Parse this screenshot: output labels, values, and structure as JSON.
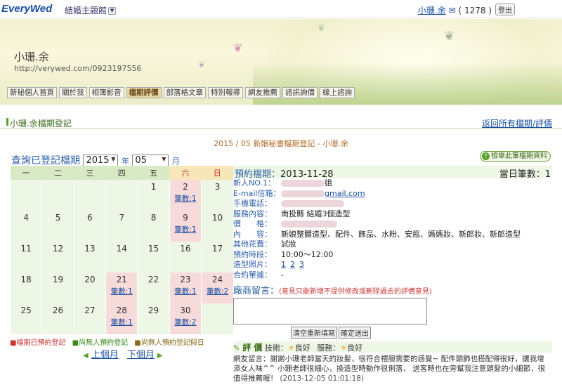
{
  "topbar": {
    "logo": "EveryWed",
    "site": "結婚主題館",
    "user_name": "小珊.余",
    "mail_count": "( 1278 )",
    "logout": "登出"
  },
  "banner": {
    "title": "小珊.余",
    "url": "http://verywed.com/0923197556",
    "nav": [
      "新秘個人首頁",
      "關於我",
      "相簿影音",
      "檔期評價",
      "部落格文章",
      "特別報導",
      "網友推薦",
      "諮訊詢價",
      "線上諮詢"
    ],
    "active_nav": "檔期評價"
  },
  "section": {
    "title": "小珊.余檔期登記",
    "back_link": "返回所有檔期/評價"
  },
  "calendar_title": "2015 / 05 新娘秘書檔期登記 - 小珊.余",
  "query": {
    "label": "查詢已登記檔期",
    "year": "2015",
    "year_unit": "年",
    "month": "05",
    "month_unit": "月"
  },
  "help_button": "檢舉此筆檔期資料",
  "calendar": {
    "weekdays": [
      "一",
      "二",
      "三",
      "四",
      "五",
      "六",
      "日"
    ],
    "weeks": [
      [
        {
          "d": ""
        },
        {
          "d": ""
        },
        {
          "d": ""
        },
        {
          "d": ""
        },
        {
          "d": "1"
        },
        {
          "d": "2",
          "c": "筆數:1"
        },
        {
          "d": "3"
        }
      ],
      [
        {
          "d": "4"
        },
        {
          "d": "5"
        },
        {
          "d": "6"
        },
        {
          "d": "7"
        },
        {
          "d": "8"
        },
        {
          "d": "9",
          "c": "筆數:1"
        },
        {
          "d": "10"
        }
      ],
      [
        {
          "d": "11"
        },
        {
          "d": "12"
        },
        {
          "d": "13"
        },
        {
          "d": "14"
        },
        {
          "d": "15"
        },
        {
          "d": "16"
        },
        {
          "d": "17"
        }
      ],
      [
        {
          "d": "18"
        },
        {
          "d": "19"
        },
        {
          "d": "20"
        },
        {
          "d": "21",
          "c": "筆數:1"
        },
        {
          "d": "22"
        },
        {
          "d": "23",
          "c": "筆數:1"
        },
        {
          "d": "24",
          "c": "筆數:2"
        }
      ],
      [
        {
          "d": "25"
        },
        {
          "d": "26"
        },
        {
          "d": "27"
        },
        {
          "d": "28",
          "c": "筆數:1"
        },
        {
          "d": "29"
        },
        {
          "d": "30",
          "c": "筆數:2"
        },
        {
          "d": ""
        }
      ]
    ]
  },
  "legend": {
    "booked": "■檔期已預約登記",
    "free": "■尚無人預約登記",
    "free_holiday": "■尚無人預約登記假日"
  },
  "month_nav": {
    "prev": "上個月",
    "next": "下個月"
  },
  "detail": {
    "date_label": "預約檔期：",
    "date": "2013-11-28",
    "day_count_label": "當日筆數：",
    "day_count": "1",
    "rows": [
      {
        "k": "新人NO.1：",
        "v": "姐"
      },
      {
        "k": "E-mail信箱：",
        "v": "gmail.com"
      },
      {
        "k": "手機電話：",
        "v": ""
      },
      {
        "k": "服務內容：",
        "v": "南投縣 結婚3個造型"
      },
      {
        "k": "價　　格：",
        "v": ""
      },
      {
        "k": "內　　容：",
        "v": "新娘整體造型、配件、飾品、水粉、安瓶、媽媽妝、新郎妝、新郎造型"
      },
      {
        "k": "其他花費：",
        "v": "試妝"
      },
      {
        "k": "預約時段：",
        "v": "10:00～12:00"
      }
    ],
    "photos_label": "造型照片：",
    "photos": [
      "1",
      "2",
      "3"
    ],
    "receipt_label": "合約單據：",
    "receipt": "-",
    "message_title": "廠商留言：",
    "message_note": "(意見只能新增不提供修改或刪除過去的評價意見)",
    "btn_clear": "清空重新填寫",
    "btn_submit": "確定送出",
    "eval_title": "評 價",
    "tech_label": "技術：",
    "tech_value": "良好",
    "service_label": "服務：",
    "service_value": "良好",
    "review": "網友留言：謝謝小珊老師當天的妝髮，很符合禮服需要的感覺~ 配件頭飾也搭配得很好，讓我增添女人味^^ 小珊老師很細心，換造型時動作很俐落， 送客時也在旁幫我注意頭髮的小細節，很值得推薦喔！",
    "review_time": "(2013-12-05 01:01:18)"
  }
}
